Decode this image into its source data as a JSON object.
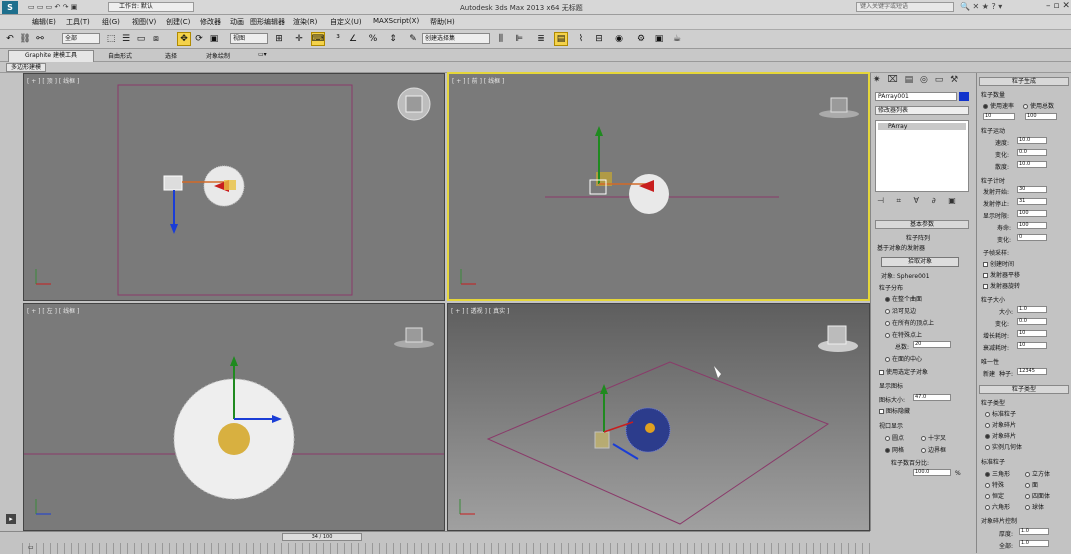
{
  "titlebar": {
    "workspace": "工作台: 默认",
    "title": "Autodesk 3ds Max  2013 x64     无标题",
    "search_placeholder": "键入关键字或短语"
  },
  "menu": [
    "编辑(E)",
    "工具(T)",
    "组(G)",
    "视图(V)",
    "创建(C)",
    "修改器",
    "动画",
    "图形编辑器",
    "渲染(R)",
    "自定义(U)",
    "MAXScript(X)",
    "帮助(H)"
  ],
  "toolbar": {
    "filter": "全部",
    "refcoord": "视图",
    "selset": "创建选择集"
  },
  "ribbon": {
    "tabs": [
      "Graphite 建模工具",
      "自由形式",
      "选择",
      "对象绘制"
    ],
    "sub": "多边形建模"
  },
  "viewports": [
    {
      "label": "[ + ] [ 顶 ] [ 线框 ]"
    },
    {
      "label": "[ + ] [ 前 ] [ 线框 ]"
    },
    {
      "label": "[ + ] [ 左 ] [ 线框 ]"
    },
    {
      "label": "[ + ] [ 透视 ] [ 真实 ]"
    }
  ],
  "cmdpanel": {
    "object_name": "PArray001",
    "modifier_list": "修改器列表",
    "stack_item": "PArray",
    "basic_params": "基本参数",
    "particle_array": "粒子阵列",
    "based_on": "基于对象的发射器",
    "pick_object": "拾取对象",
    "object_label": "对象: Sphere001",
    "distribution": "粒子分布",
    "dist_options": [
      "在整个曲面",
      "沿可见边",
      "在所有的顶点上",
      "在特殊点上",
      "在面的中心"
    ],
    "total_label": "总数:",
    "total_value": "20",
    "use_selected": "使用选定子对象",
    "display_icon": "显示图标",
    "icon_size_label": "图标大小:",
    "icon_size_value": "47.0",
    "icon_hidden": "图标隐藏",
    "viewport_display": "视口显示",
    "vd_options": [
      "圆点",
      "十字叉",
      "网格",
      "边界框"
    ],
    "percent_label": "粒子数百分比:",
    "percent_value": "100.0"
  },
  "rollout": {
    "gen_title": "粒子生成",
    "qty_title": "粒子数量",
    "use_rate": "使用速率",
    "use_total": "使用总数",
    "rate_value": "10",
    "total_value": "100",
    "motion_title": "粒子运动",
    "speed_label": "速度:",
    "speed_value": "10.0",
    "variation_label": "变化:",
    "variation_value": "0.0",
    "divergence_label": "散度:",
    "divergence_value": "10.0",
    "timing_title": "粒子计时",
    "emit_start_label": "发射开始:",
    "emit_start_value": "30",
    "emit_stop_label": "发射停止:",
    "emit_stop_value": "31",
    "display_until_label": "显示时限:",
    "display_until_value": "100",
    "life_label": "寿命:",
    "life_value": "100",
    "life_var_label": "变化:",
    "life_var_value": "0",
    "subframe_title": "子帧采样:",
    "creation_time": "创建时间",
    "emitter_translation": "发射器平移",
    "emitter_rotation": "发射器旋转",
    "size_title": "粒子大小",
    "size_label": "大小:",
    "size_value": "1.0",
    "size_var_label": "变化:",
    "size_var_value": "0.0",
    "grow_label": "增长耗时:",
    "grow_value": "10",
    "fade_label": "衰减耗时:",
    "fade_value": "10",
    "unique_title": "唯一性",
    "new_label": "新建",
    "seed_label": "种子:",
    "seed_value": "12345",
    "type_title": "粒子类型",
    "ptypes_title": "粒子类型",
    "ptypes": [
      "标准粒子",
      "对象碎片",
      "对象碎片",
      "实例几何体"
    ],
    "std_title": "标准粒子",
    "std_options": [
      "三角形",
      "立方体",
      "特殊",
      "面",
      "恒定",
      "四面体",
      "六角形",
      "球体"
    ],
    "frag_title": "对象碎片控制",
    "thick_label": "厚度:",
    "thick_value": "1.0",
    "all_label": "全部:",
    "all_value": "1.0"
  },
  "timebar": {
    "frame": "34 / 100"
  },
  "colors": {
    "active_border": "#e5d63a",
    "vp_bg": "#7a7a7a"
  }
}
